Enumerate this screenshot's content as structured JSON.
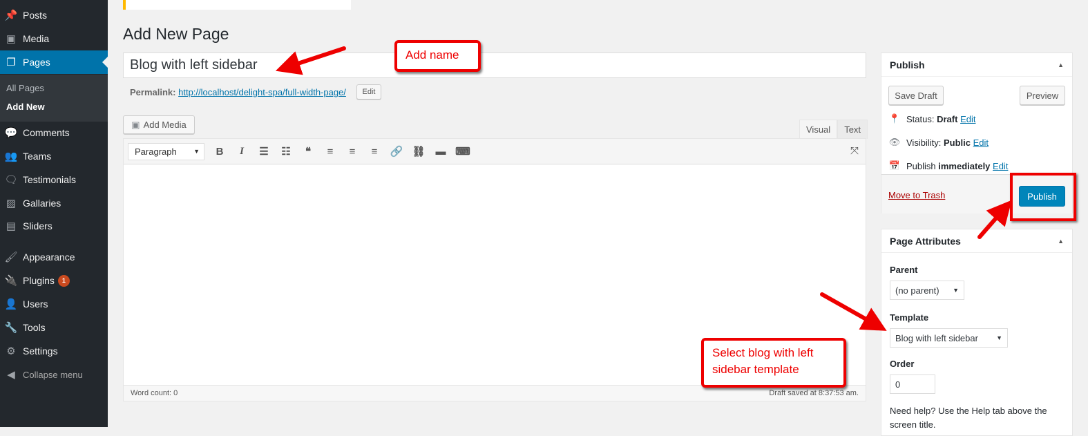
{
  "sidebar": {
    "items": [
      {
        "label": "Posts",
        "icon": "pin-icon"
      },
      {
        "label": "Media",
        "icon": "media-icon"
      },
      {
        "label": "Pages",
        "icon": "pages-icon"
      },
      {
        "label": "Comments",
        "icon": "comment-icon"
      },
      {
        "label": "Teams",
        "icon": "groups-icon"
      },
      {
        "label": "Testimonials",
        "icon": "testimonial-icon"
      },
      {
        "label": "Gallaries",
        "icon": "gallery-icon"
      },
      {
        "label": "Sliders",
        "icon": "slides-icon"
      },
      {
        "label": "Appearance",
        "icon": "brush-icon"
      },
      {
        "label": "Plugins",
        "icon": "plugin-icon",
        "badge": "1"
      },
      {
        "label": "Users",
        "icon": "user-icon"
      },
      {
        "label": "Tools",
        "icon": "wrench-icon"
      },
      {
        "label": "Settings",
        "icon": "settings-icon"
      },
      {
        "label": "Collapse menu",
        "icon": "collapse-icon"
      }
    ],
    "submenu": [
      "All Pages",
      "Add New"
    ]
  },
  "page": {
    "title": "Add New Page",
    "post_title": "Blog with left sidebar",
    "permalink_label": "Permalink:",
    "permalink_url": "http://localhost/delight-spa/full-width-page/",
    "permalink_edit": "Edit"
  },
  "editor": {
    "add_media": "Add Media",
    "tabs": [
      "Visual",
      "Text"
    ],
    "active_tab": "Visual",
    "format": "Paragraph",
    "word_count": "Word count: 0",
    "draft_saved": "Draft saved at 8:37:53 am."
  },
  "publish": {
    "heading": "Publish",
    "save_draft": "Save Draft",
    "preview": "Preview",
    "status_label": "Status:",
    "status_value": "Draft",
    "visibility_label": "Visibility:",
    "visibility_value": "Public",
    "publish_label": "Publish",
    "publish_value": "immediately",
    "edit": "Edit",
    "trash": "Move to Trash",
    "publish_button": "Publish"
  },
  "attributes": {
    "heading": "Page Attributes",
    "parent_label": "Parent",
    "parent_value": "(no parent)",
    "template_label": "Template",
    "template_value": "Blog with left sidebar",
    "order_label": "Order",
    "order_value": "0",
    "help": "Need help? Use the Help tab above the screen title."
  },
  "annotations": {
    "name": "Add name",
    "template": "Select blog with left sidebar template",
    "color": "#e00000"
  }
}
